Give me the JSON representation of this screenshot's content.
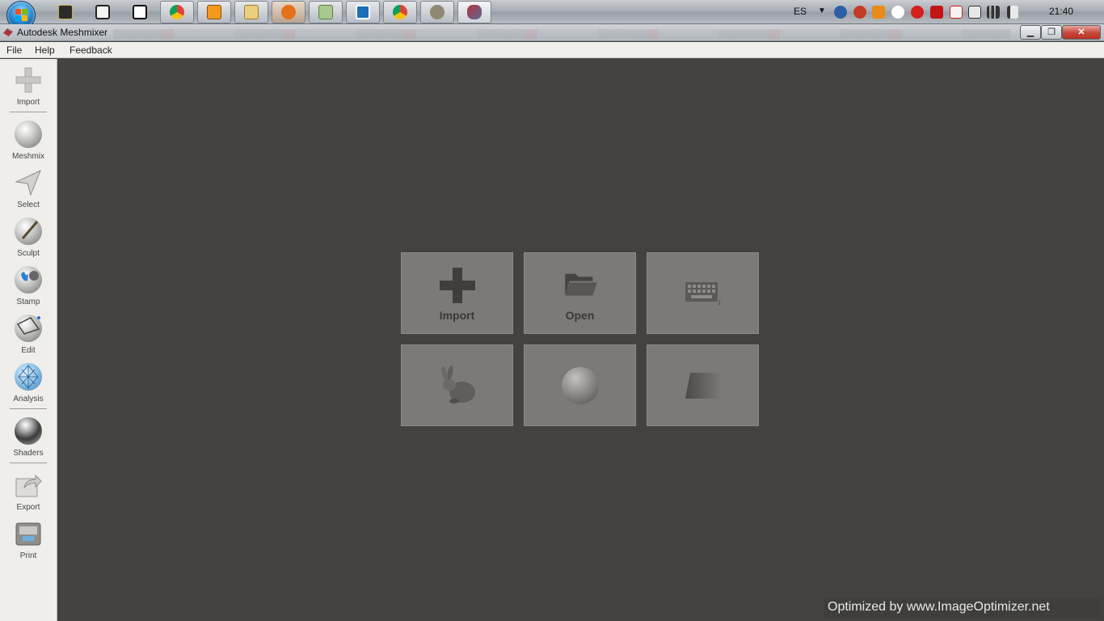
{
  "taskbar": {
    "language": "ES",
    "clock": "21:40",
    "buttons": [
      {
        "name": "start-button"
      },
      {
        "name": "taskbar-app-1",
        "icon": "terminal-icon"
      },
      {
        "name": "taskbar-app-2",
        "icon": "calculator-icon"
      },
      {
        "name": "taskbar-app-3",
        "icon": "notepad-icon"
      },
      {
        "name": "taskbar-chrome-1",
        "icon": "chrome-icon"
      },
      {
        "name": "taskbar-media-player",
        "icon": "media-player-icon"
      },
      {
        "name": "taskbar-explorer",
        "icon": "folder-icon"
      },
      {
        "name": "taskbar-app-7",
        "icon": "paint-icon"
      },
      {
        "name": "taskbar-app-8",
        "icon": "image-viewer-icon"
      },
      {
        "name": "taskbar-app-9",
        "icon": "app-icon"
      },
      {
        "name": "taskbar-chrome-2",
        "icon": "chrome-icon"
      },
      {
        "name": "taskbar-gimp",
        "icon": "gimp-icon"
      },
      {
        "name": "taskbar-meshmixer",
        "icon": "meshmixer-icon"
      }
    ]
  },
  "window": {
    "title": "Autodesk Meshmixer",
    "minimize": "▁",
    "restore": "❐",
    "close": "✕"
  },
  "menu": {
    "items": [
      "File",
      "Help",
      "Feedback"
    ]
  },
  "toolbar": {
    "items": [
      {
        "label": "Import",
        "icon": "plus-icon"
      },
      {
        "label": "Meshmix",
        "icon": "face-sphere-icon"
      },
      {
        "label": "Select",
        "icon": "arrow-select-icon"
      },
      {
        "label": "Sculpt",
        "icon": "brush-sphere-icon"
      },
      {
        "label": "Stamp",
        "icon": "stamp-icon"
      },
      {
        "label": "Edit",
        "icon": "edit-sphere-icon"
      },
      {
        "label": "Analysis",
        "icon": "mesh-sphere-icon"
      },
      {
        "label": "Shaders",
        "icon": "shader-sphere-icon"
      },
      {
        "label": "Export",
        "icon": "export-icon"
      },
      {
        "label": "Print",
        "icon": "printer-icon"
      }
    ]
  },
  "start_tiles": [
    {
      "label": "Import",
      "icon": "plus-icon"
    },
    {
      "label": "Open",
      "icon": "folder-open-icon"
    },
    {
      "label": "",
      "icon": "keyboard-icon"
    },
    {
      "label": "",
      "icon": "bunny-icon"
    },
    {
      "label": "",
      "icon": "sphere-icon"
    },
    {
      "label": "",
      "icon": "plane-icon"
    }
  ],
  "watermark": "Optimized by www.ImageOptimizer.net"
}
